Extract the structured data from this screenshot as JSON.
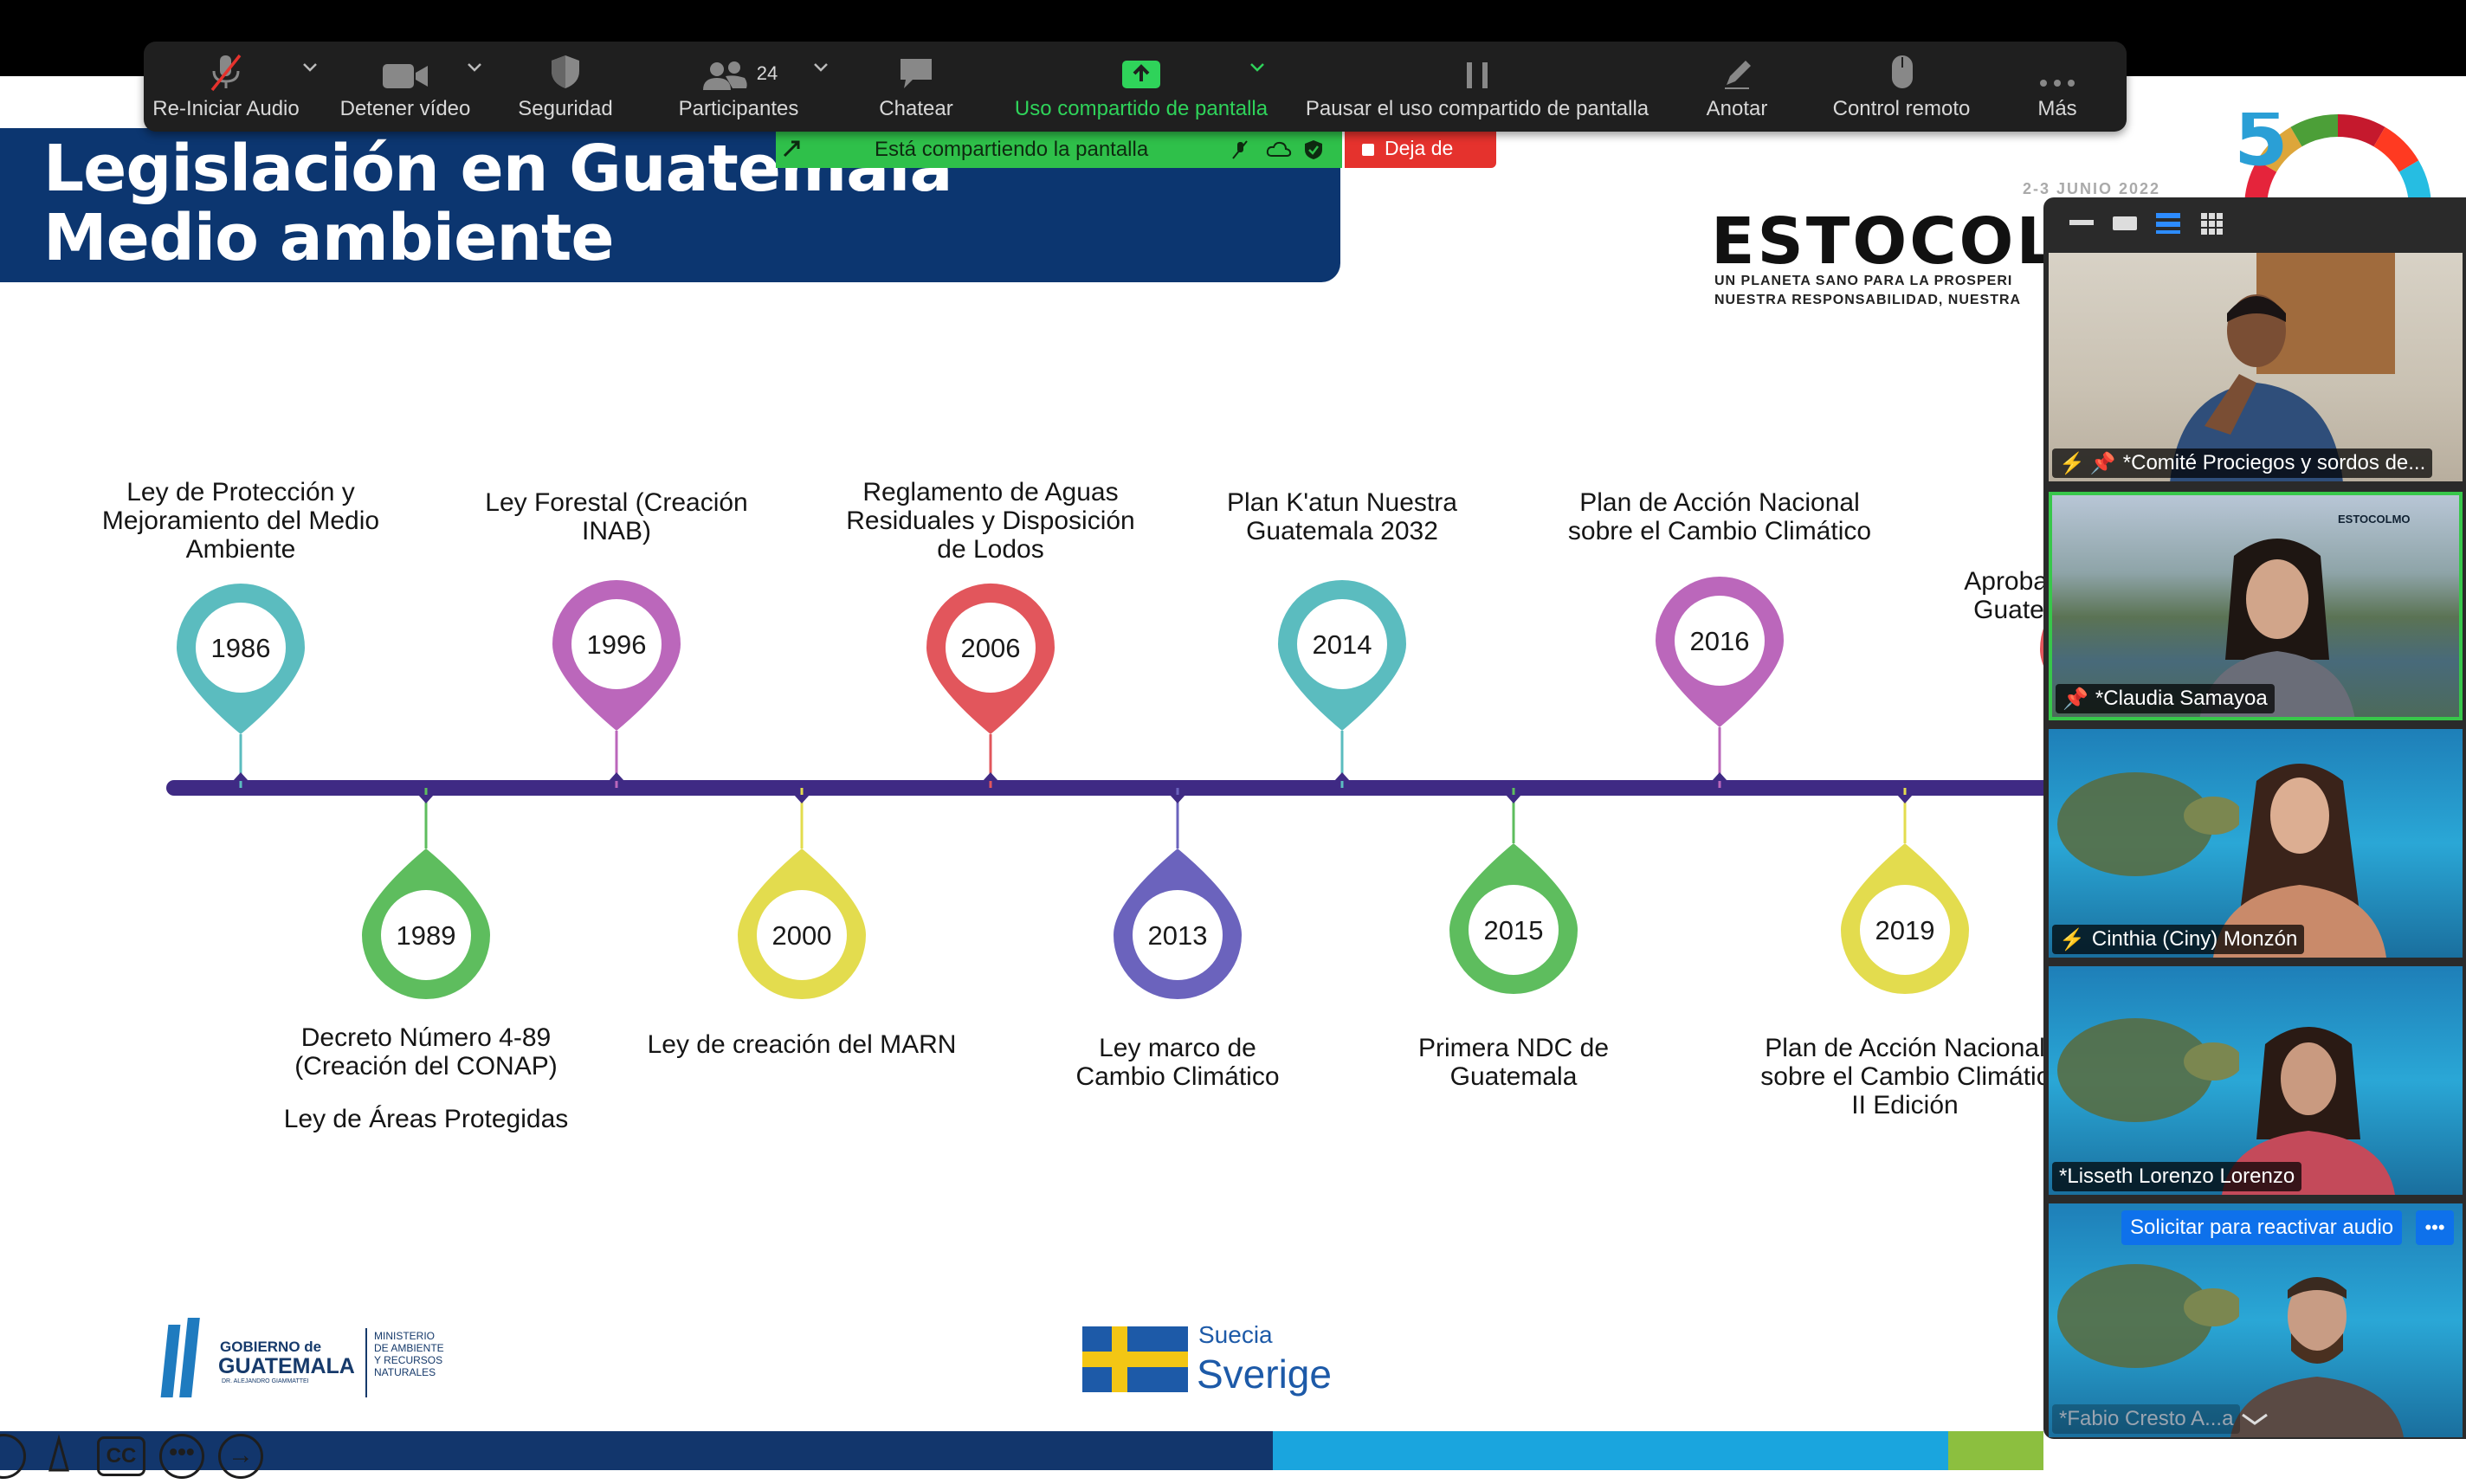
{
  "toolbar": {
    "items": [
      {
        "label": "Re-Iniciar Audio",
        "icon": "microphone-muted-icon"
      },
      {
        "label": "Detener vídeo",
        "icon": "video-camera-icon"
      },
      {
        "label": "Seguridad",
        "icon": "shield-icon"
      },
      {
        "label": "Participantes",
        "icon": "participants-icon",
        "count": "24"
      },
      {
        "label": "Chatear",
        "icon": "chat-bubble-icon"
      },
      {
        "label": "Uso compartido de pantalla",
        "icon": "share-screen-icon"
      },
      {
        "label": "Pausar el uso compartido de pantalla",
        "icon": "pause-icon"
      },
      {
        "label": "Anotar",
        "icon": "pen-icon"
      },
      {
        "label": "Control remoto",
        "icon": "mouse-icon"
      },
      {
        "label": "Más",
        "icon": "more-dots-icon"
      }
    ],
    "active_color": "#2fd35a",
    "background": "#1f1f1f"
  },
  "share_bar": {
    "text": "Está compartiendo la pantalla",
    "stop_label": "Deja de",
    "color": "#2fc04a",
    "stop_color": "#e5322d"
  },
  "slide": {
    "title_line1": "Legislación en Guatemala",
    "title_line2": "Medio ambiente",
    "title_bg": "#0c3670",
    "header": {
      "name": "ESTOCOL",
      "date": "2-3 JUNIO 2022",
      "subtitle_line1": "UN PLANETA SANO PARA LA PROSPERI",
      "subtitle_line2": "NUESTRA RESPONSABILIDAD, NUESTRA"
    },
    "timeline_top": [
      {
        "year": "1986",
        "label": [
          "Ley de Protección y",
          "Mejoramiento del Medio",
          "Ambiente"
        ],
        "color": "#5bbcbf"
      },
      {
        "year": "1996",
        "label": [
          "Ley Forestal (Creación",
          "INAB)"
        ],
        "color": "#bb67bb"
      },
      {
        "year": "2006",
        "label": [
          "Reglamento de Aguas",
          "Residuales y Disposición",
          "de Lodos"
        ],
        "color": "#e2565c"
      },
      {
        "year": "2014",
        "label": [
          "Plan K'atun Nuestra",
          "Guatemala 2032"
        ],
        "color": "#5bbcbf"
      },
      {
        "year": "2016",
        "label": [
          "Plan de Acción Nacional",
          "sobre el Cambio Climático"
        ],
        "color": "#bb67bb"
      },
      {
        "year": "",
        "label": [
          "Aprobación de",
          "Guatemala a"
        ],
        "color": "#e2565c"
      }
    ],
    "timeline_bottom": [
      {
        "year": "1989",
        "label": [
          "Decreto Número 4-89",
          "(Creación del CONAP)",
          "",
          "Ley de Áreas Protegidas"
        ],
        "color": "#5ebd5e"
      },
      {
        "year": "2000",
        "label": [
          "Ley de creación del MARN"
        ],
        "color": "#e3dc4e"
      },
      {
        "year": "2013",
        "label": [
          "Ley marco de",
          "Cambio Climático"
        ],
        "color": "#6b63bd"
      },
      {
        "year": "2015",
        "label": [
          "Primera NDC de",
          "Guatemala"
        ],
        "color": "#5ebd5e"
      },
      {
        "year": "2019",
        "label": [
          "Plan de Acción Nacional",
          "sobre el Cambio Climátic",
          "II Edición"
        ],
        "color": "#e3dc4e"
      }
    ],
    "logos": {
      "gov_line1": "GOBIERNO de",
      "gov_line2": "GUATEMALA",
      "gov_line3": "DR. ALEJANDRO GIAMMATTEI",
      "ministry": [
        "MINISTERIO",
        "DE AMBIENTE",
        "Y RECURSOS",
        "NATURALES"
      ],
      "sweden_top": "Suecia",
      "sweden_bottom": "Sverige"
    }
  },
  "participants": [
    {
      "name": "*Comité Prociegos y sordos de...",
      "pinned": true,
      "muted": true
    },
    {
      "name": "*Claudia Samayoa",
      "pinned": true,
      "muted": false,
      "active": true
    },
    {
      "name": "Cinthia (Ciny) Monzón",
      "pinned": false,
      "muted": true
    },
    {
      "name": "*Lisseth Lorenzo Lorenzo",
      "pinned": false,
      "muted": false
    },
    {
      "name": "*Fabio Cresto A...a",
      "pinned": false,
      "muted": false,
      "banner": "Solicitar para reactivar audio"
    }
  ],
  "bottom_controls": [
    {
      "icon": "power-icon"
    },
    {
      "icon": "laser-pointer-icon"
    },
    {
      "icon": "captions-icon",
      "label": "CC"
    },
    {
      "icon": "more-dots-icon"
    },
    {
      "icon": "arrow-right-icon"
    }
  ]
}
